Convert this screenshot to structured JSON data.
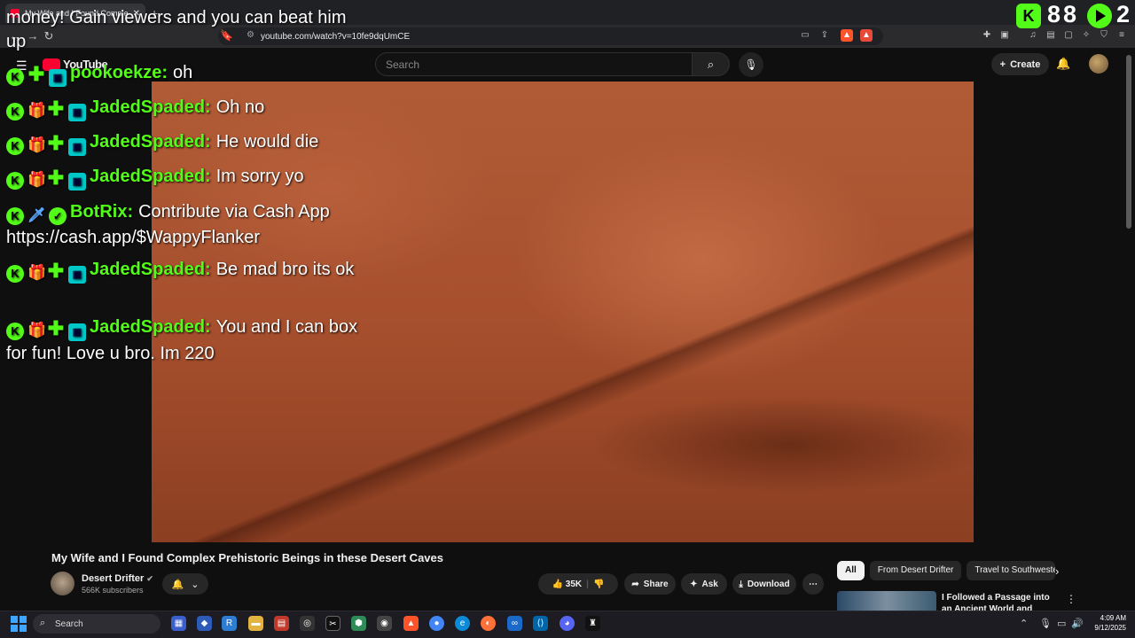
{
  "browser": {
    "tab_title": "My Wife and I Found Comple",
    "url": "youtube.com/watch?v=10fe9dqUmCE"
  },
  "youtube": {
    "logo_text": "YouTube",
    "search_placeholder": "Search",
    "create_label": "Create"
  },
  "overlay": {
    "top_text": "money! Gain viewers and you can beat him up",
    "kick_counter_1": "88",
    "kick_counter_2": "2",
    "messages": [
      {
        "user": "pookoekze:",
        "text": "oh"
      },
      {
        "user": "JadedSpaded:",
        "text": "Oh no"
      },
      {
        "user": "JadedSpaded:",
        "text": "He would die"
      },
      {
        "user": "JadedSpaded:",
        "text": "Im sorry yo"
      },
      {
        "user": "BotRix:",
        "text": "Contribute via Cash App https://cash.app/$WappyFlanker"
      },
      {
        "user": "JadedSpaded:",
        "text": "Be mad bro its ok"
      },
      {
        "user": "JadedSpaded:",
        "text": "You and I can box for fun! Love u bro. Im 220"
      }
    ]
  },
  "video": {
    "title": "My Wife and I Found Complex Prehistoric Beings in these Desert Caves",
    "channel_name": "Desert Drifter",
    "subscribers": "566K subscribers",
    "likes": "35K",
    "share_label": "Share",
    "ask_label": "Ask",
    "download_label": "Download"
  },
  "sidebar": {
    "chips": [
      "All",
      "From Desert Drifter",
      "Travel to Southweste"
    ],
    "rec_title": "I Followed a Passage into an Ancient World and Found This"
  },
  "taskbar": {
    "search_label": "Search",
    "time": "4:09 AM",
    "date": "9/12/2025"
  },
  "colors": {
    "kick_green": "#53fc18",
    "youtube_red": "#ff0033"
  }
}
